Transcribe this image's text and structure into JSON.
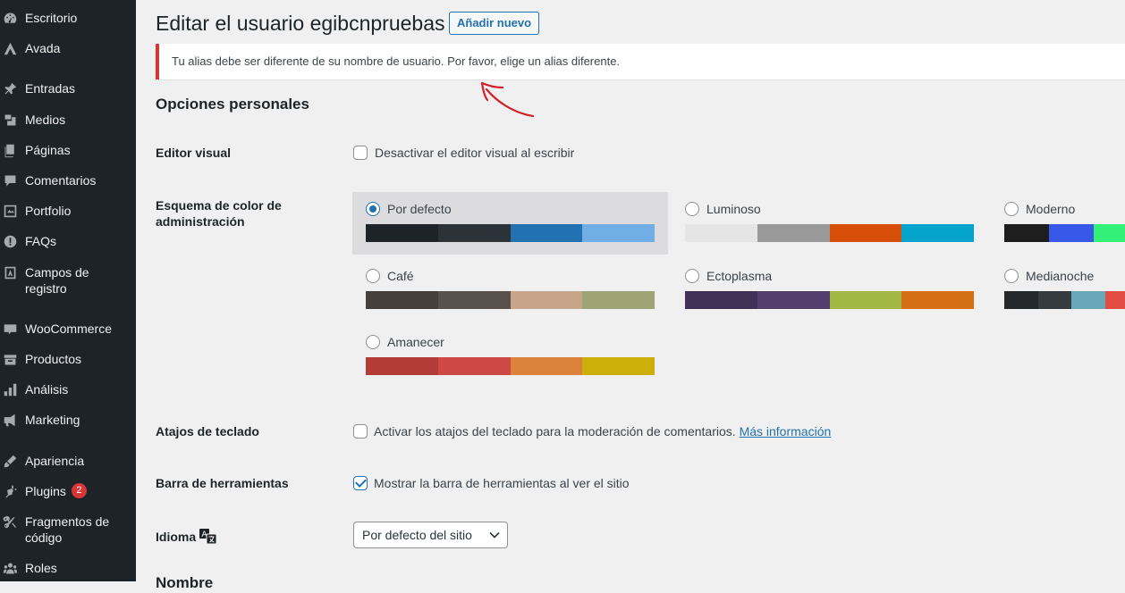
{
  "sidebar": {
    "items": [
      {
        "label": "Escritorio",
        "icon": "dashboard-icon"
      },
      {
        "label": "Avada",
        "icon": "avada-icon"
      },
      {
        "label": "Entradas",
        "icon": "pin-icon"
      },
      {
        "label": "Medios",
        "icon": "media-icon"
      },
      {
        "label": "Páginas",
        "icon": "pages-icon"
      },
      {
        "label": "Comentarios",
        "icon": "comments-icon"
      },
      {
        "label": "Portfolio",
        "icon": "portfolio-icon"
      },
      {
        "label": "FAQs",
        "icon": "faq-icon"
      },
      {
        "label": "Campos de registro",
        "icon": "fields-icon"
      },
      {
        "label": "WooCommerce",
        "icon": "woo-icon"
      },
      {
        "label": "Productos",
        "icon": "products-icon"
      },
      {
        "label": "Análisis",
        "icon": "analytics-icon"
      },
      {
        "label": "Marketing",
        "icon": "megaphone-icon"
      },
      {
        "label": "Apariencia",
        "icon": "appearance-icon"
      },
      {
        "label": "Plugins",
        "icon": "plugins-icon",
        "badge": "2"
      },
      {
        "label": "Fragmentos de código",
        "icon": "snippets-icon"
      },
      {
        "label": "Roles",
        "icon": "roles-icon"
      }
    ]
  },
  "header": {
    "title": "Editar el usuario egibcnpruebas",
    "add_new": "Añadir nuevo"
  },
  "notice": {
    "text": "Tu alias debe ser diferente de su nombre de usuario. Por favor, elige un alias diferente."
  },
  "section": {
    "title": "Opciones personales"
  },
  "visual_editor": {
    "label": "Editor visual",
    "option": "Desactivar el editor visual al escribir",
    "checked": false
  },
  "color_scheme": {
    "label": "Esquema de color de administración",
    "options": [
      {
        "name": "Por defecto",
        "selected": true,
        "colors": [
          "#1d2327",
          "#2c3338",
          "#2271b1",
          "#72aee6"
        ]
      },
      {
        "name": "Luminoso",
        "selected": false,
        "colors": [
          "#e5e5e5",
          "#999999",
          "#d64e07",
          "#04a4cc"
        ]
      },
      {
        "name": "Moderno",
        "selected": false,
        "colors": [
          "#1e1e1e",
          "#3858e9",
          "#33f078"
        ]
      },
      {
        "name": "Café",
        "selected": false,
        "colors": [
          "#46403c",
          "#59524c",
          "#c7a589",
          "#9ea476"
        ]
      },
      {
        "name": "Ectoplasma",
        "selected": false,
        "colors": [
          "#413256",
          "#523f6d",
          "#a3b745",
          "#d46f15"
        ]
      },
      {
        "name": "Medianoche",
        "selected": false,
        "colors": [
          "#25282b",
          "#363b3f",
          "#69a8bb",
          "#e14d43"
        ]
      },
      {
        "name": "Amanecer",
        "selected": false,
        "colors": [
          "#b43c38",
          "#cf4944",
          "#dd823b",
          "#ccaf0b"
        ]
      }
    ]
  },
  "keyboard_shortcuts": {
    "label": "Atajos de teclado",
    "option": "Activar los atajos del teclado para la moderación de comentarios.",
    "link": "Más información",
    "checked": false
  },
  "toolbar": {
    "label": "Barra de herramientas",
    "option": "Mostrar la barra de herramientas al ver el sitio",
    "checked": true
  },
  "language": {
    "label": "Idioma",
    "icon": "translate-icon",
    "selected": "Por defecto del sitio"
  },
  "cutoff": {
    "text": "Nombre"
  }
}
